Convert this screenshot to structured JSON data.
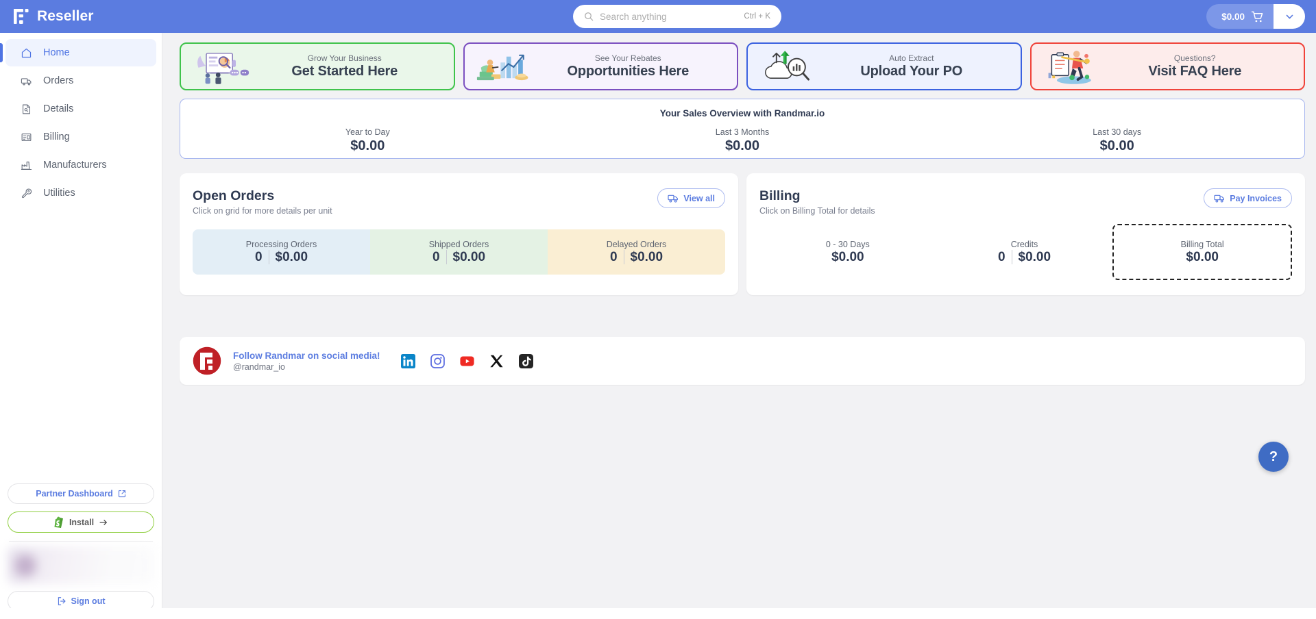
{
  "topbar": {
    "brand": "Reseller",
    "brand_logo_icon": "randmar-logo-icon",
    "search": {
      "placeholder": "Search anything",
      "value": "",
      "shortcut": "Ctrl + K",
      "icon": "search-icon"
    },
    "cart": {
      "amount": "$0.00",
      "icon": "shopping-cart-icon",
      "toggle_icon": "chevron-down-icon"
    }
  },
  "sidebar": {
    "items": [
      {
        "label": "Home",
        "icon": "home-icon",
        "active": true
      },
      {
        "label": "Orders",
        "icon": "truck-icon",
        "active": false
      },
      {
        "label": "Details",
        "icon": "document-icon",
        "active": false
      },
      {
        "label": "Billing",
        "icon": "invoice-icon",
        "active": false
      },
      {
        "label": "Manufacturers",
        "icon": "factory-icon",
        "active": false
      },
      {
        "label": "Utilities",
        "icon": "wrench-icon",
        "active": false
      }
    ],
    "partner_dashboard": {
      "label": "Partner Dashboard",
      "icon": "external-link-icon"
    },
    "install": {
      "label": "Install",
      "icon": "shopify-icon",
      "arrow_icon": "arrow-right-icon"
    },
    "sign_out": {
      "label": "Sign out",
      "icon": "sign-out-icon"
    }
  },
  "promos": [
    {
      "sub": "Grow Your Business",
      "title": "Get Started Here",
      "theme": "green",
      "art": "presentation-illustration"
    },
    {
      "sub": "See Your Rebates",
      "title": "Opportunities Here",
      "theme": "purple",
      "art": "growth-chart-illustration"
    },
    {
      "sub": "Auto Extract",
      "title": "Upload Your PO",
      "theme": "blue",
      "art": "cloud-upload-illustration"
    },
    {
      "sub": "Questions?",
      "title": "Visit FAQ Here",
      "theme": "red",
      "art": "clipboard-person-illustration"
    }
  ],
  "overview": {
    "title": "Your Sales Overview with Randmar.io",
    "columns": [
      {
        "label": "Year to Day",
        "value": "$0.00"
      },
      {
        "label": "Last 3 Months",
        "value": "$0.00"
      },
      {
        "label": "Last 30 days",
        "value": "$0.00"
      }
    ]
  },
  "open_orders": {
    "title": "Open Orders",
    "subtitle": "Click on grid for more details per unit",
    "action": {
      "label": "View all",
      "icon": "truck-icon"
    },
    "stats": [
      {
        "label": "Processing Orders",
        "count": "0",
        "amount": "$0.00",
        "bg": "bg-blue"
      },
      {
        "label": "Shipped Orders",
        "count": "0",
        "amount": "$0.00",
        "bg": "bg-green"
      },
      {
        "label": "Delayed Orders",
        "count": "0",
        "amount": "$0.00",
        "bg": "bg-orange"
      }
    ]
  },
  "billing": {
    "title": "Billing",
    "subtitle": "Click on Billing Total for details",
    "action": {
      "label": "Pay Invoices",
      "icon": "truck-icon"
    },
    "stats": [
      {
        "label": "0 - 30 Days",
        "count": "",
        "amount": "$0.00"
      },
      {
        "label": "Credits",
        "count": "0",
        "amount": "$0.00"
      },
      {
        "label": "Billing Total",
        "count": "",
        "amount": "$0.00"
      }
    ]
  },
  "social": {
    "logo_icon": "randmar-circle-logo-icon",
    "title": "Follow Randmar on social media!",
    "handle": "@randmar_io",
    "links": [
      {
        "name": "linkedin-icon"
      },
      {
        "name": "instagram-icon"
      },
      {
        "name": "youtube-icon"
      },
      {
        "name": "x-twitter-icon"
      },
      {
        "name": "tiktok-icon"
      }
    ]
  },
  "help": {
    "label": "?"
  },
  "colors": {
    "topbar": "#5b7ce0",
    "accent": "#5b7ce0",
    "canvas": "#f2f2f4",
    "green": "#3fc34b",
    "purple": "#7b4fc0",
    "blue": "#3b62e0",
    "red": "#f0433a"
  }
}
